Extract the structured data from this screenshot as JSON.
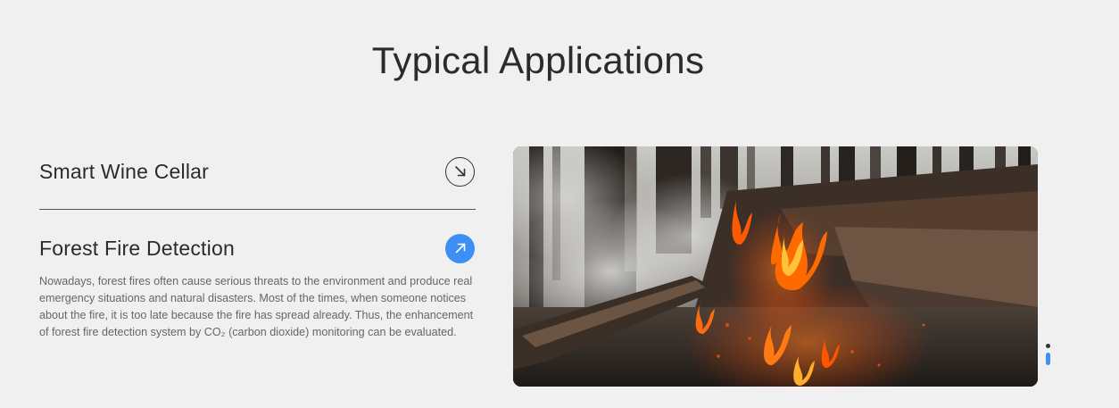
{
  "section": {
    "title": "Typical Applications"
  },
  "applications": [
    {
      "title": "Smart Wine Cellar",
      "state": "collapsed",
      "icon": "arrow-down-right-icon"
    },
    {
      "title": "Forest Fire Detection",
      "state": "expanded",
      "icon": "arrow-up-right-icon",
      "description": "Nowadays, forest fires often cause serious threats to the environment and produce real emergency situations and natural disasters. Most of the times, when someone notices about the fire, it is too late because the fire has spread already. Thus, the enhancement of forest fire detection system by CO₂ (carbon dioxide) monitoring can be evaluated."
    }
  ],
  "image": {
    "subject": "forest-fire-photo"
  },
  "pager": {
    "total": 2,
    "active": 2
  },
  "colors": {
    "background": "#f0f0f0",
    "accent": "#3d8ff5",
    "text": "#2b2b2b",
    "muted_text": "#666666"
  }
}
